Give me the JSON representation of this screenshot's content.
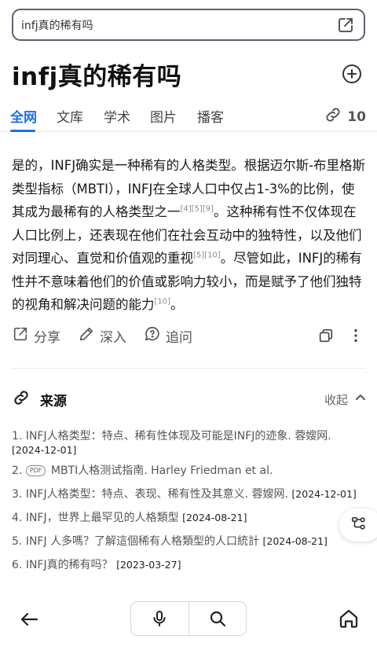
{
  "search": {
    "query": "infj真的稀有吗"
  },
  "title": "infj真的稀有吗",
  "tabs": [
    {
      "label": "全网",
      "active": true
    },
    {
      "label": "文库"
    },
    {
      "label": "学术"
    },
    {
      "label": "图片"
    },
    {
      "label": "播客"
    }
  ],
  "link_count": "10",
  "answer": {
    "p1": "是的，INFJ确实是一种稀有的人格类型。根据迈尔斯-布里格斯类型指标（MBTI），INFJ在全球人口中仅占1-3%的比例，使其成为最稀有的人格类型之一",
    "cite1": "[4][5][9]",
    "p2": "。这种稀有性不仅体现在人口比例上，还表现在他们在社会互动中的独特性，以及他们对同理心、直觉和价值观的重视",
    "cite2": "[5][10]",
    "p3": "。尽管如此，INFJ的稀有性并不意味着他们的价值或影响力较小，而是赋予了他们独特的视角和解决问题的能力",
    "cite3": "[10]",
    "p4": "。"
  },
  "actions": {
    "share": "分享",
    "deeper": "深入",
    "followup": "追问"
  },
  "sources_section": {
    "title": "来源",
    "collapse": "收起"
  },
  "sources": [
    {
      "num": "1.",
      "text": "INFJ人格类型：特点、稀有性体现及可能是INFJ的迹象. 蓉嫂网.",
      "date": "[2024-12-01]"
    },
    {
      "num": "2.",
      "badge": "PDF",
      "text": "MBTI人格测试指南. Harley Friedman et al.",
      "date": ""
    },
    {
      "num": "3.",
      "text": "INFJ人格类型：特点、表现、稀有性及其意义. 蓉嫂网.",
      "date": "[2024-12-01]"
    },
    {
      "num": "4.",
      "text": "INFJ，世界上最罕见的人格類型",
      "date": "[2024-08-21]"
    },
    {
      "num": "5.",
      "text": "INFJ 人多嗎？了解這個稀有人格類型的人口統計",
      "date": "[2024-08-21]"
    },
    {
      "num": "6.",
      "text": "INFJ真的稀有吗？",
      "date": "[2023-03-27]"
    }
  ],
  "colors": {
    "accent": "#1a6ff2",
    "text": "#1a1a1a",
    "muted": "#555555"
  },
  "icons": [
    "open-external-icon",
    "add-circle-icon",
    "link-icon",
    "share-icon",
    "pencil-icon",
    "question-bubble-icon",
    "copy-icon",
    "more-vertical-icon",
    "chevron-up-icon",
    "mind-map-icon",
    "arrow-left-icon",
    "microphone-icon",
    "search-icon",
    "home-icon"
  ]
}
